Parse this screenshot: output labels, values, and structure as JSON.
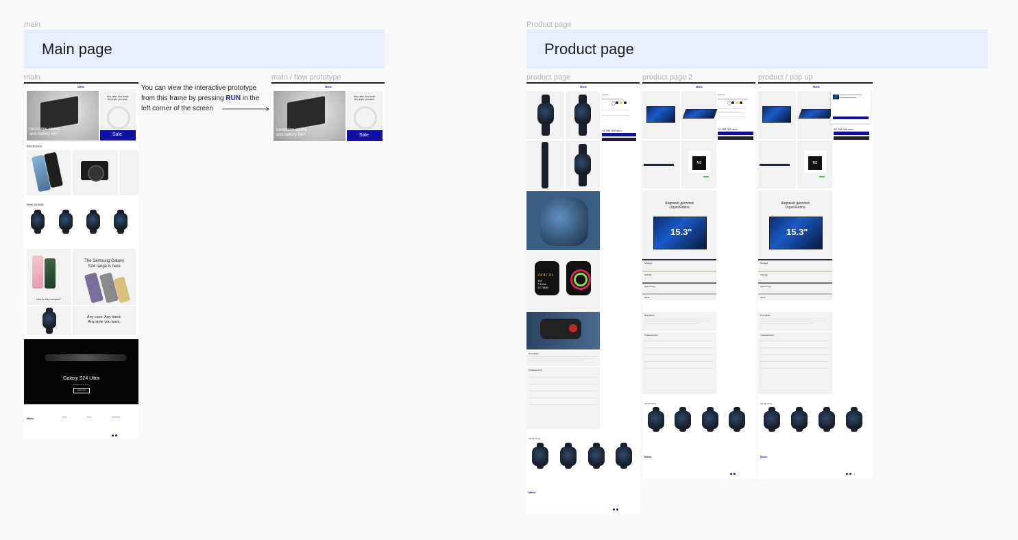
{
  "canvas": {
    "sections": {
      "main_label": "main",
      "main_title": "Main page",
      "product_label": "Product page",
      "product_title": "Product page"
    },
    "frame_labels": {
      "main": "main",
      "flow": "main / flow prototype",
      "product": "product page",
      "product2": "product page 2",
      "popup": "product / pop up"
    },
    "note": {
      "line1": "You can view the interactive prototype",
      "line2_prefix": "from this frame by pressing ",
      "run": "RUN",
      "line2_suffix": " in the",
      "line3": "left corner of the screen"
    }
  },
  "site": {
    "logo": "Marki",
    "hero_text_line1": "Incredible speed",
    "hero_text_line2": "and battery life?",
    "side_card_line1": "Any case. Any band.",
    "side_card_line2": "Any style you want.",
    "sale_label": "Sale",
    "electronics_heading": "Electronics",
    "new_arrivals_heading": "New arrivals",
    "samsung_line1": "The Samsung Galaxy",
    "samsung_line2": "S24 range is here",
    "compare_caption": "How do they compare?",
    "band_line1": "Any case. Any band.",
    "band_line2": "Any style you want.",
    "s24_title": "Galaxy S24 Ultra",
    "s24_sub": "Galaxy AI is here",
    "s24_button": "Learn more",
    "price_watch": "15 290 000 sum",
    "price_mac": "15 290 000 sum",
    "liquid_retina_line1": "Широкий дисплей",
    "liquid_retina_line2": "Liquid Retina",
    "screen_size": "15.3\"",
    "chip": "M2",
    "colors": [
      "Midnight",
      "Starlight",
      "Space Gray",
      "Silver"
    ],
    "description_heading": "Description",
    "characteristics_heading": "Characteristics",
    "similar_heading": "Similar items",
    "watch_time": "21:47.01",
    "watch_stats_line1": "148",
    "watch_stats_line2": "7:13/ml",
    "watch_stats_line3": "13.78KM"
  },
  "colors": {
    "banner": "#e6eeff",
    "brand_navy": "#0f0fa0",
    "canvas": "#f9f9f9",
    "frame_label": "#b3b3b3"
  }
}
